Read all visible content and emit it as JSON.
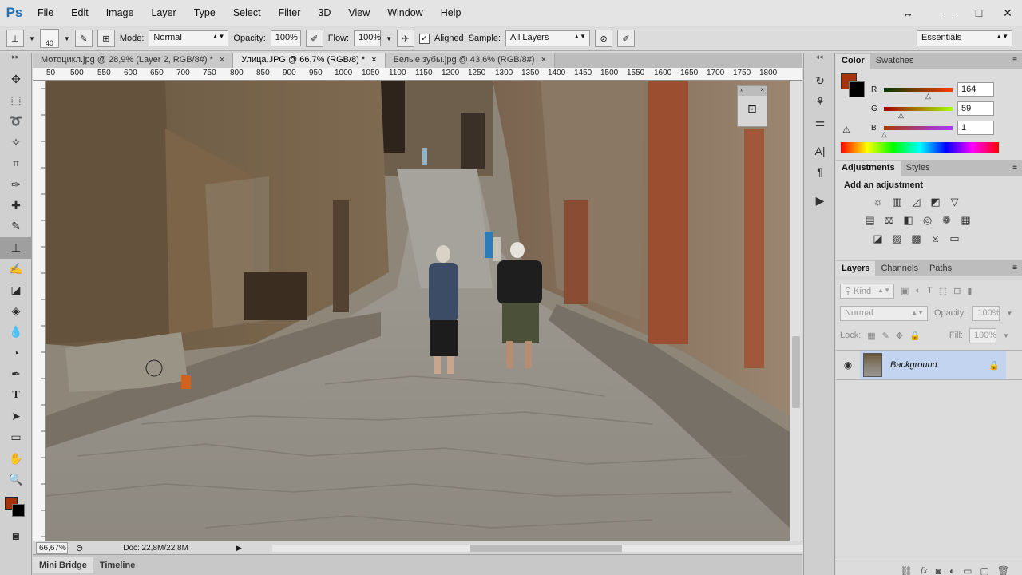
{
  "app": {
    "logo": "Ps"
  },
  "menu": [
    "File",
    "Edit",
    "Image",
    "Layer",
    "Type",
    "Select",
    "Filter",
    "3D",
    "View",
    "Window",
    "Help"
  ],
  "window_controls": [
    "↔",
    "—",
    "□",
    "✕"
  ],
  "options": {
    "brush_size": "40",
    "mode_label": "Mode:",
    "mode_value": "Normal",
    "opacity_label": "Opacity:",
    "opacity_value": "100%",
    "flow_label": "Flow:",
    "flow_value": "100%",
    "aligned_label": "Aligned",
    "sample_label": "Sample:",
    "sample_value": "All Layers",
    "workspace": "Essentials"
  },
  "tabs": [
    {
      "label": "Мотоцикл.jpg @ 28,9% (Layer 2, RGB/8#) *",
      "close": "×"
    },
    {
      "label": "Улица.JPG @ 66,7% (RGB/8) *",
      "close": "×"
    },
    {
      "label": "Белые зубы.jpg @ 43,6% (RGB/8#)",
      "close": "×"
    }
  ],
  "ruler_ticks": [
    "50",
    "500",
    "550",
    "600",
    "650",
    "700",
    "750",
    "800",
    "850",
    "900",
    "950",
    "1000",
    "1050",
    "1100",
    "1150",
    "1200",
    "1250",
    "1300",
    "1350",
    "1400",
    "1450",
    "1500",
    "1550",
    "1600",
    "1650",
    "1700",
    "1750",
    "1800"
  ],
  "status": {
    "zoom": "66,67%",
    "doc": "Doc: 22,8M/22,8M"
  },
  "bottom_tabs": [
    "Mini Bridge",
    "Timeline"
  ],
  "color_panel": {
    "tabs": [
      "Color",
      "Swatches"
    ],
    "fg_color": "#a4320a",
    "r_label": "R",
    "r_value": "164",
    "g_label": "G",
    "g_value": "59",
    "b_label": "B",
    "b_value": "1"
  },
  "adjustments": {
    "tabs": [
      "Adjustments",
      "Styles"
    ],
    "title": "Add an adjustment"
  },
  "layers": {
    "tabs": [
      "Layers",
      "Channels",
      "Paths"
    ],
    "kind": "Kind",
    "blend": "Normal",
    "opacity_label": "Opacity:",
    "opacity_value": "100%",
    "lock_label": "Lock:",
    "fill_label": "Fill:",
    "fill_value": "100%",
    "layer_name": "Background"
  }
}
